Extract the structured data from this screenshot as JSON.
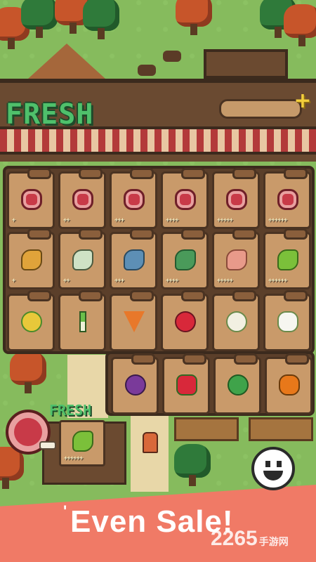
{
  "header": {
    "title": "FRESH",
    "plus_label": "+"
  },
  "shelf": {
    "rows": [
      [
        {
          "icon": "meat-icon",
          "stars": "+"
        },
        {
          "icon": "meat-icon",
          "stars": "++"
        },
        {
          "icon": "meat-icon",
          "stars": "+++"
        },
        {
          "icon": "meat-icon",
          "stars": "++++"
        },
        {
          "icon": "meat-icon",
          "stars": "+++++"
        },
        {
          "icon": "meat-icon",
          "stars": "++++++"
        }
      ],
      [
        {
          "icon": "fish-icon",
          "stars": "+"
        },
        {
          "icon": "fish-icon",
          "stars": "++"
        },
        {
          "icon": "fish-icon",
          "stars": "+++"
        },
        {
          "icon": "fish-icon",
          "stars": "++++"
        },
        {
          "icon": "fish-icon",
          "stars": "+++++"
        },
        {
          "icon": "fish-icon",
          "stars": "++++++"
        }
      ],
      [
        {
          "icon": "corn-icon",
          "stars": ""
        },
        {
          "icon": "leek-icon",
          "stars": ""
        },
        {
          "icon": "carrot-icon",
          "stars": ""
        },
        {
          "icon": "radish-icon",
          "stars": ""
        },
        {
          "icon": "turnip-icon",
          "stars": ""
        },
        {
          "icon": "daikon-icon",
          "stars": ""
        }
      ],
      [
        {
          "icon": "eggplant-icon",
          "stars": ""
        },
        {
          "icon": "pepper-icon",
          "stars": ""
        },
        {
          "icon": "cabbage-icon",
          "stars": ""
        },
        {
          "icon": "pumpkin-icon",
          "stars": ""
        }
      ]
    ]
  },
  "shop": {
    "sign": "FRESH",
    "featured_stars": "++++++"
  },
  "banner": {
    "quote_mark": "'",
    "text": "Even Sale!"
  },
  "watermark": {
    "brand": "2265",
    "suffix": "手游网"
  },
  "colors": {
    "title_green": "#4fc06b",
    "banner_coral": "#f07a66",
    "wood": "#c99a6a"
  }
}
